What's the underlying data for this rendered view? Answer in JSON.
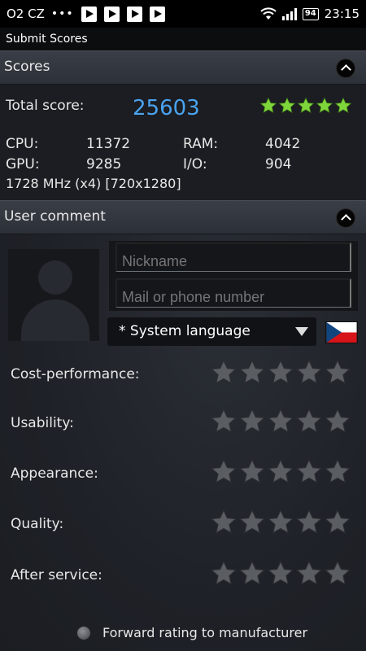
{
  "status_bar": {
    "carrier": "O2 CZ",
    "dots": "•••",
    "battery": "94",
    "time": "23:15"
  },
  "app_bar": {
    "title": "Submit Scores"
  },
  "scores_section": {
    "header": "Scores",
    "total_label": "Total score:",
    "total_value": "25603",
    "star_count": 5,
    "stats": {
      "cpu_label": "CPU:",
      "cpu_value": "11372",
      "ram_label": "RAM:",
      "ram_value": "4042",
      "gpu_label": "GPU:",
      "gpu_value": "9285",
      "io_label": "I/O:",
      "io_value": "904"
    },
    "spec": "1728 MHz (x4) [720x1280]"
  },
  "comment_section": {
    "header": "User comment",
    "nickname_placeholder": "Nickname",
    "contact_placeholder": "Mail or phone number",
    "language_selected": "* System language",
    "ratings": [
      {
        "label": "Cost-performance:",
        "value": 0
      },
      {
        "label": "Usability:",
        "value": 0
      },
      {
        "label": "Appearance:",
        "value": 0
      },
      {
        "label": "Quality:",
        "value": 0
      },
      {
        "label": "After service:",
        "value": 0
      }
    ],
    "forward_label": "Forward rating to manufacturer"
  },
  "colors": {
    "accent_blue": "#4aa3f0",
    "star_green": "#7ed63a",
    "star_empty": "#5a5d62"
  }
}
